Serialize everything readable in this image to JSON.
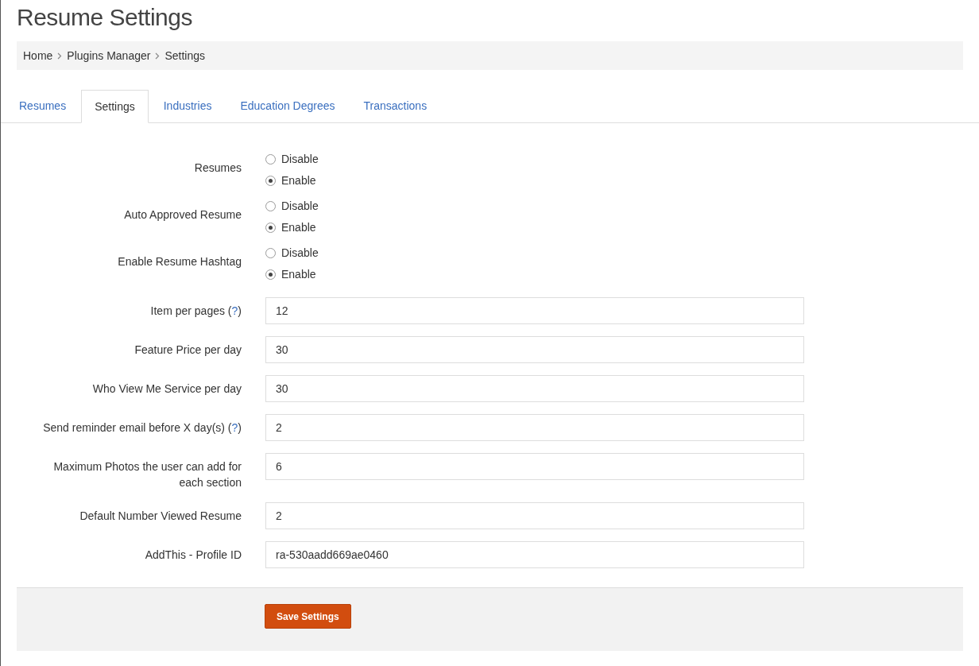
{
  "title": "Resume Settings",
  "breadcrumb": [
    "Home",
    "Plugins Manager",
    "Settings"
  ],
  "tabs": [
    {
      "label": "Resumes",
      "selected": false
    },
    {
      "label": "Settings",
      "selected": true
    },
    {
      "label": "Industries",
      "selected": false
    },
    {
      "label": "Education Degrees",
      "selected": false
    },
    {
      "label": "Transactions",
      "selected": false
    }
  ],
  "fields": [
    {
      "kind": "radio",
      "label": "Resumes",
      "options": [
        {
          "label": "Disable",
          "selected": false
        },
        {
          "label": "Enable",
          "selected": true
        }
      ]
    },
    {
      "kind": "radio",
      "label": "Auto Approved Resume",
      "options": [
        {
          "label": "Disable",
          "selected": false
        },
        {
          "label": "Enable",
          "selected": true
        }
      ]
    },
    {
      "kind": "radio",
      "label": "Enable Resume Hashtag",
      "options": [
        {
          "label": "Disable",
          "selected": false
        },
        {
          "label": "Enable",
          "selected": true
        }
      ]
    },
    {
      "kind": "text",
      "label": "Item per pages (",
      "help": "?",
      "label_after": ")",
      "value": "12"
    },
    {
      "kind": "text",
      "label": "Feature Price per day",
      "value": "30"
    },
    {
      "kind": "text",
      "label": "Who View Me Service per day",
      "value": "30"
    },
    {
      "kind": "text",
      "label": "Send reminder email before X day(s) (",
      "help": "?",
      "label_after": ")",
      "value": "2"
    },
    {
      "kind": "text",
      "label": "Maximum Photos the user can add for each section",
      "value": "6"
    },
    {
      "kind": "text",
      "label": "Default Number Viewed Resume",
      "value": "2"
    },
    {
      "kind": "text",
      "label": "AddThis - Profile ID",
      "value": "ra-530aadd669ae0460"
    }
  ],
  "save_button": "Save Settings"
}
